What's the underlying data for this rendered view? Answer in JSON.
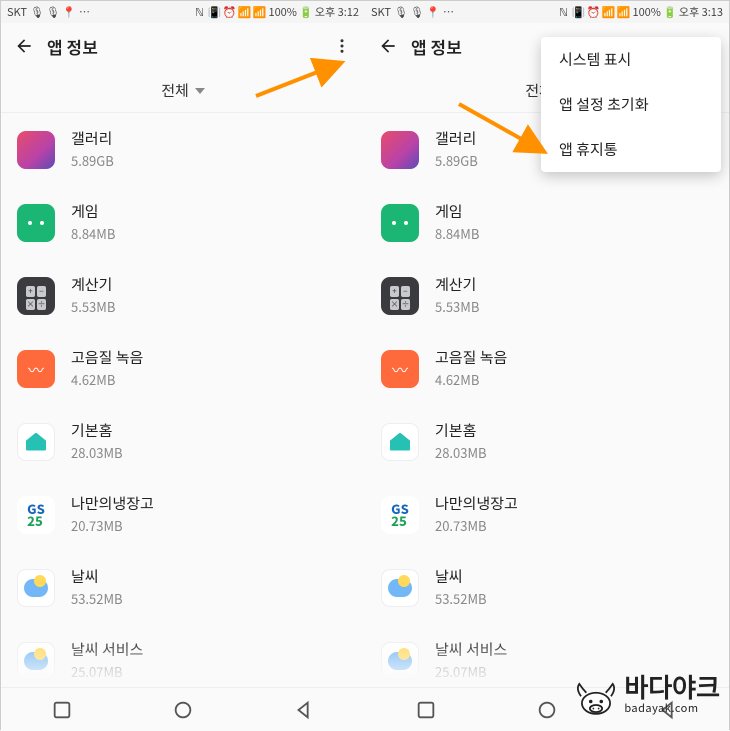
{
  "left": {
    "statusbar": {
      "carrier": "SKT",
      "battery": "100%",
      "time": "오후 3:12"
    },
    "header": {
      "title": "앱 정보"
    },
    "filter": {
      "label": "전체"
    },
    "apps": [
      {
        "name": "갤러리",
        "size": "5.89GB",
        "icon": "gallery"
      },
      {
        "name": "게임",
        "size": "8.84MB",
        "icon": "game"
      },
      {
        "name": "계산기",
        "size": "5.53MB",
        "icon": "calc"
      },
      {
        "name": "고음질 녹음",
        "size": "4.62MB",
        "icon": "rec"
      },
      {
        "name": "기본홈",
        "size": "28.03MB",
        "icon": "home"
      },
      {
        "name": "나만의냉장고",
        "size": "20.73MB",
        "icon": "gs"
      },
      {
        "name": "날씨",
        "size": "53.52MB",
        "icon": "weather"
      },
      {
        "name": "날씨 서비스",
        "size": "25.07MB",
        "icon": "weather"
      }
    ]
  },
  "right": {
    "statusbar": {
      "carrier": "SKT",
      "battery": "100%",
      "time": "오후 3:13"
    },
    "header": {
      "title": "앱 정보"
    },
    "filter": {
      "label": "전체"
    },
    "popup": {
      "items": [
        "시스템 표시",
        "앱 설정 초기화",
        "앱 휴지통"
      ]
    },
    "apps": [
      {
        "name": "갤러리",
        "size": "5.89GB",
        "icon": "gallery"
      },
      {
        "name": "게임",
        "size": "8.84MB",
        "icon": "game"
      },
      {
        "name": "계산기",
        "size": "5.53MB",
        "icon": "calc"
      },
      {
        "name": "고음질 녹음",
        "size": "4.62MB",
        "icon": "rec"
      },
      {
        "name": "기본홈",
        "size": "28.03MB",
        "icon": "home"
      },
      {
        "name": "나만의냉장고",
        "size": "20.73MB",
        "icon": "gs"
      },
      {
        "name": "날씨",
        "size": "53.52MB",
        "icon": "weather"
      },
      {
        "name": "날씨 서비스",
        "size": "25.07MB",
        "icon": "weather"
      }
    ]
  },
  "watermark": {
    "title": "바다야크",
    "sub": "badayak.com"
  }
}
